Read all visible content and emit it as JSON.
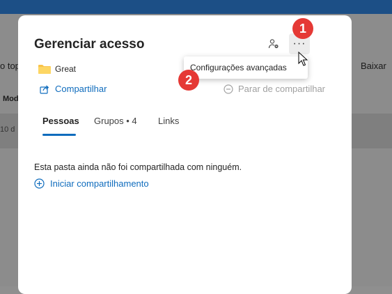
{
  "background": {
    "left_text_top": "o top",
    "left_header": "Mod",
    "left_date": "10 d",
    "right_action": "Baixar"
  },
  "dialog": {
    "title": "Gerenciar acesso",
    "more_button_label": "···",
    "tooltip": "Configurações avançadas",
    "folder_name": "Great",
    "share_label": "Compartilhar",
    "stop_sharing_label": "Parar de compartilhar",
    "tabs": [
      "Pessoas",
      "Grupos • 4",
      "Links"
    ],
    "selected_tab": "Pessoas",
    "empty_message": "Esta pasta ainda não foi compartilhada com ninguém.",
    "start_sharing_label": "Iniciar compartilhamento"
  },
  "annotations": {
    "badge_1": "1",
    "badge_2": "2"
  },
  "colors": {
    "accent": "#0f6cbd",
    "badge": "#e53935",
    "topbar": "#1c4f86",
    "folder": "#f9c349"
  }
}
